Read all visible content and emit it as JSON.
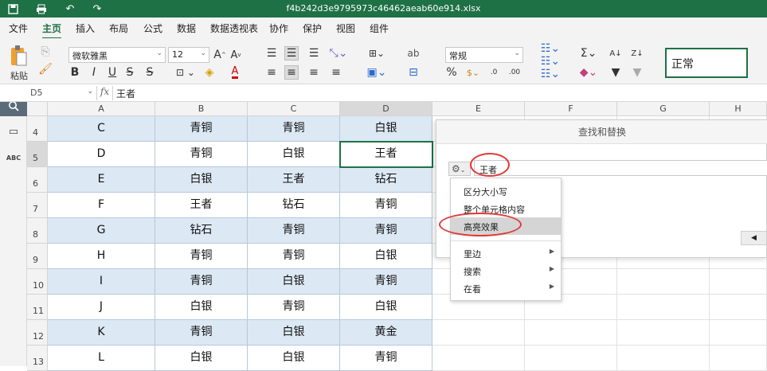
{
  "title": "f4b242d3e9795973c46462aeab60e914.xlsx",
  "menu": [
    "文件",
    "主页",
    "插入",
    "布局",
    "公式",
    "数据",
    "数据透视表",
    "协作",
    "保护",
    "视图",
    "组件"
  ],
  "active_menu": "主页",
  "ribbon": {
    "paste_label": "粘贴",
    "font_name": "微软雅黑",
    "font_size": "12",
    "number_format": "常规",
    "cell_style": "正常"
  },
  "formula_bar": {
    "cell_ref": "D5",
    "fx": "fx",
    "value": "王者"
  },
  "columns": [
    "A",
    "B",
    "C",
    "D",
    "E",
    "F",
    "G",
    "H"
  ],
  "rows": [
    {
      "num": "4",
      "cells": [
        "C",
        "青铜",
        "青铜",
        "白银"
      ]
    },
    {
      "num": "5",
      "cells": [
        "D",
        "青铜",
        "白银",
        "王者"
      ]
    },
    {
      "num": "6",
      "cells": [
        "E",
        "白银",
        "王者",
        "钻石"
      ]
    },
    {
      "num": "7",
      "cells": [
        "F",
        "王者",
        "钻石",
        "青铜"
      ]
    },
    {
      "num": "8",
      "cells": [
        "G",
        "钻石",
        "青铜",
        "青铜"
      ]
    },
    {
      "num": "9",
      "cells": [
        "H",
        "青铜",
        "青铜",
        "白银"
      ]
    },
    {
      "num": "10",
      "cells": [
        "I",
        "青铜",
        "白银",
        "青铜"
      ]
    },
    {
      "num": "11",
      "cells": [
        "J",
        "白银",
        "青铜",
        "白银"
      ]
    },
    {
      "num": "12",
      "cells": [
        "K",
        "青铜",
        "白银",
        "黄金"
      ]
    },
    {
      "num": "13",
      "cells": [
        "L",
        "白银",
        "白银",
        "青铜"
      ]
    }
  ],
  "dialog": {
    "title": "查找和替换",
    "find_value": "王者",
    "options": [
      {
        "label": "区分大小写",
        "submenu": false
      },
      {
        "label": "整个单元格内容",
        "submenu": false
      },
      {
        "label": "高亮效果",
        "submenu": false,
        "highlighted": true
      },
      {
        "label": "里边",
        "submenu": true
      },
      {
        "label": "搜索",
        "submenu": true
      },
      {
        "label": "在看",
        "submenu": true
      }
    ]
  },
  "colors": {
    "accent": "#1e7145",
    "annotation": "#e03a3a",
    "cell_shade": "#dce8f4"
  }
}
